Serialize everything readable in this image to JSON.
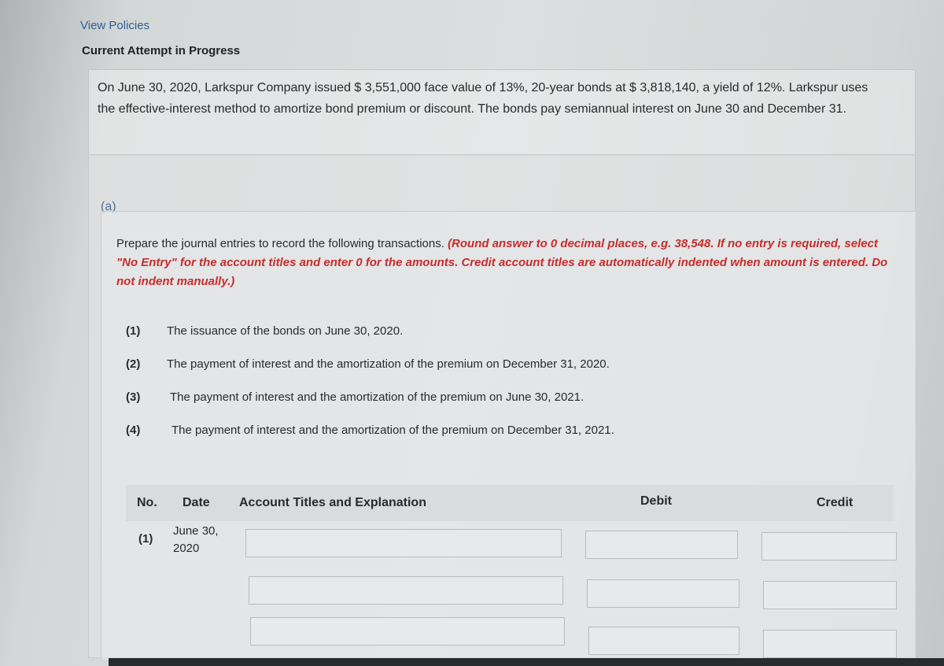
{
  "header": {
    "view_policies": "View Policies",
    "attempt_status": "Current Attempt in Progress"
  },
  "question": {
    "text": "On June 30, 2020, Larkspur Company issued $ 3,551,000 face value of 13%, 20-year bonds at $ 3,818,140, a yield of 12%. Larkspur uses the effective-interest method to amortize bond premium or discount. The bonds pay semiannual interest on June 30 and December 31."
  },
  "part": {
    "label": "(a)",
    "instruction_plain": "Prepare the journal entries to record the following transactions. ",
    "instruction_red": "(Round answer to 0 decimal places, e.g. 38,548. If no entry is required, select \"No Entry\" for the account titles and enter 0 for the amounts. Credit account titles are automatically indented when amount is entered. Do not indent manually.)"
  },
  "transactions": [
    {
      "num": "(1)",
      "text": "The issuance of the bonds on June 30, 2020."
    },
    {
      "num": "(2)",
      "text": "The payment of interest and the amortization of the premium on December 31, 2020."
    },
    {
      "num": "(3)",
      "text": "The payment of interest and the amortization of the premium on June 30, 2021."
    },
    {
      "num": "(4)",
      "text": "The payment of interest and the amortization of the premium on December 31, 2021."
    }
  ],
  "table": {
    "headers": {
      "no": "No.",
      "date": "Date",
      "account": "Account Titles and Explanation",
      "debit": "Debit",
      "credit": "Credit"
    },
    "rows": [
      {
        "no": "(1)",
        "date_line1": "June 30,",
        "date_line2": "2020"
      }
    ]
  },
  "colors": {
    "link": "#2f5d95",
    "instruction_red": "#c62d2d",
    "part_label": "#4f6f9a"
  }
}
